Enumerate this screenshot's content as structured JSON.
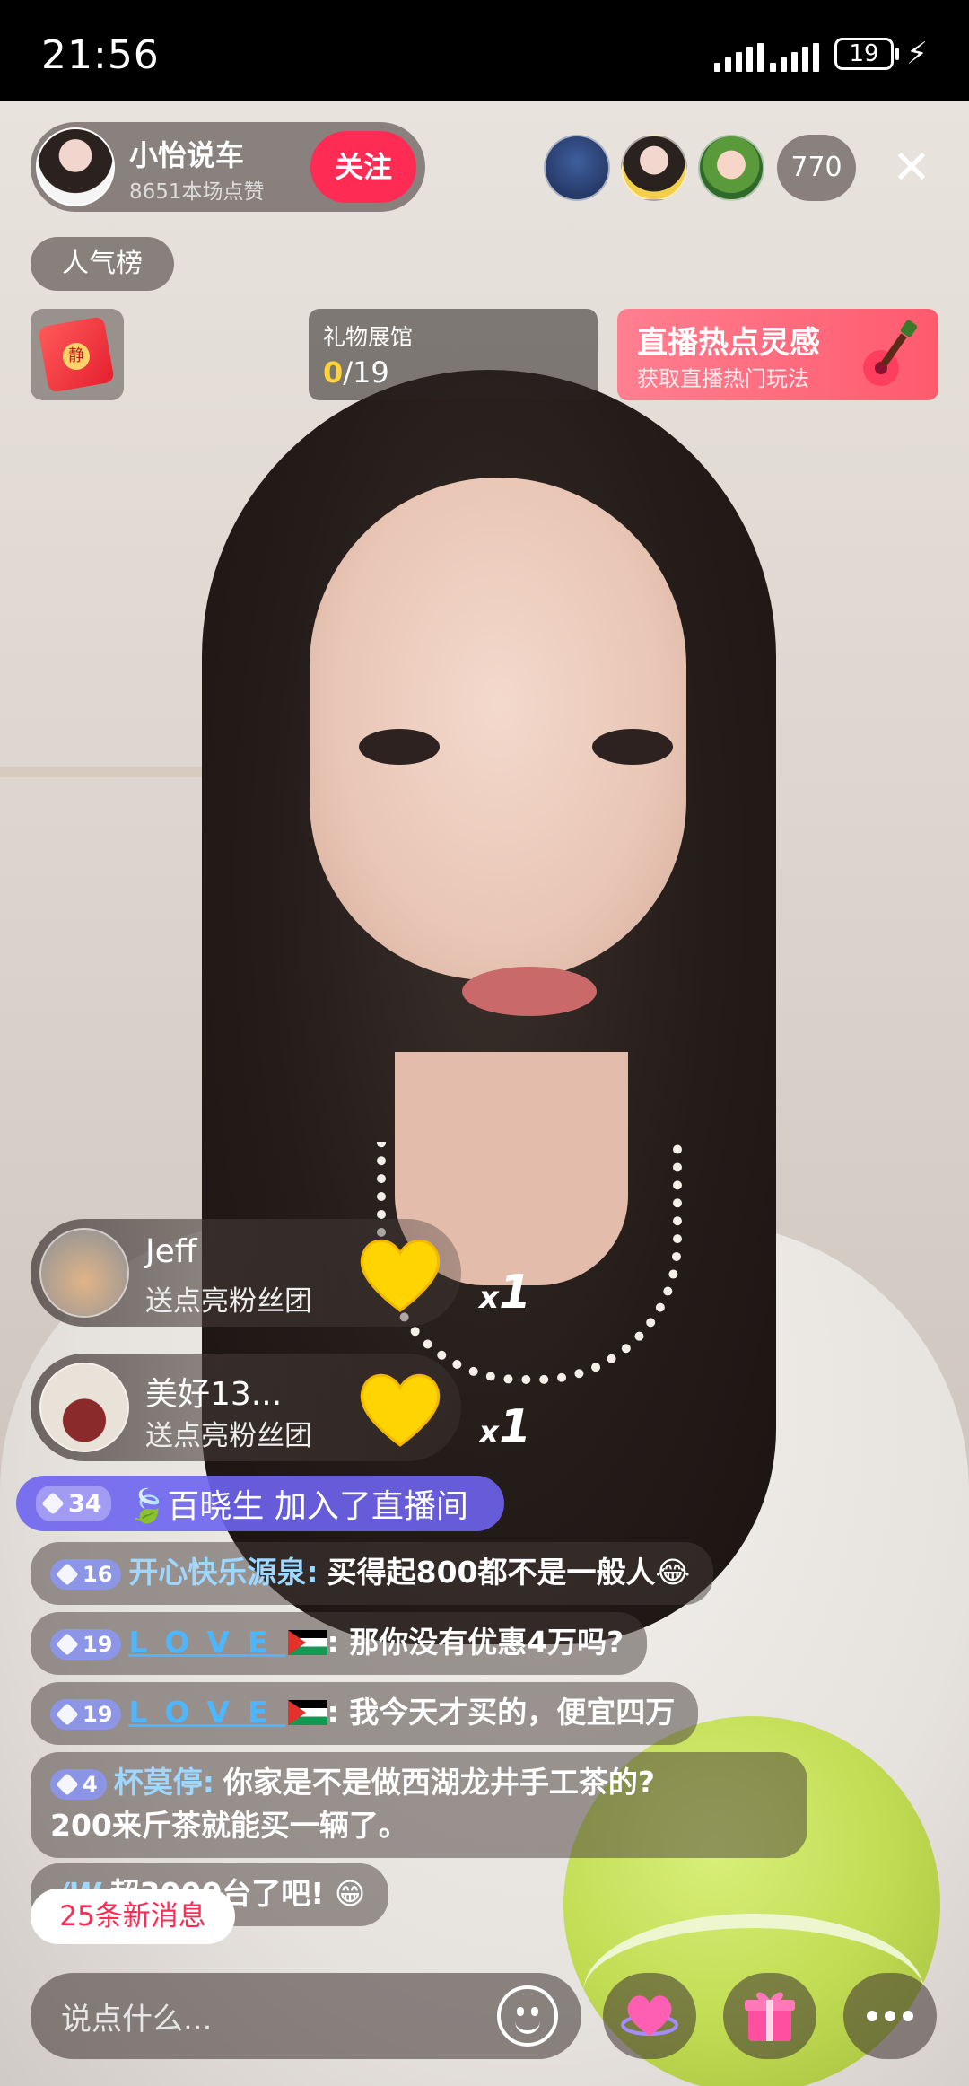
{
  "status_bar": {
    "time": "21:56",
    "battery": "19"
  },
  "host": {
    "name": "小怡说车",
    "likes": "8651本场点赞",
    "follow_label": "关注"
  },
  "viewers": {
    "count": "770"
  },
  "rank_label": "人气榜",
  "redpack_seal": "静",
  "gift_hall": {
    "title": "礼物展馆",
    "collected": "0",
    "total": "/19"
  },
  "hot_card": {
    "title": "直播热点灵感",
    "subtitle": "获取直播热门玩法"
  },
  "gifts": [
    {
      "user": "Jeff",
      "action": "送点亮粉丝团",
      "count_prefix": "x",
      "count": "1"
    },
    {
      "user": "美好13...",
      "action": "送点亮粉丝团",
      "count_prefix": "x",
      "count": "1"
    }
  ],
  "join": {
    "level": "34",
    "text": "🍃百晓生 加入了直播间"
  },
  "comments": [
    {
      "level": "16",
      "user": "开心快乐源泉:",
      "text": "买得起800都不是一般人😂"
    },
    {
      "level": "19",
      "user": "LOVE",
      "text": ": 那你没有优惠4万吗?"
    },
    {
      "level": "19",
      "user": "LOVE",
      "text": ": 我今天才买的，便宜四万"
    },
    {
      "level": "4",
      "user": "杯莫停:",
      "text": "你家是不是做西湖龙井手工茶的?",
      "text2": "200来斤茶就能买一辆了。"
    },
    {
      "user": "/W",
      "text": "超3000台了吧! 😁"
    }
  ],
  "new_messages": "25条新消息",
  "input_placeholder": "说点什么...",
  "colors": {
    "accent": "#fe2c55",
    "join_bg": "#6e64f0",
    "username": "#9ed7ff"
  },
  "icons": [
    "close-icon",
    "emoji-icon",
    "heart-planet-icon",
    "gift-icon",
    "more-icon",
    "guitar-icon",
    "red-envelope-icon"
  ]
}
